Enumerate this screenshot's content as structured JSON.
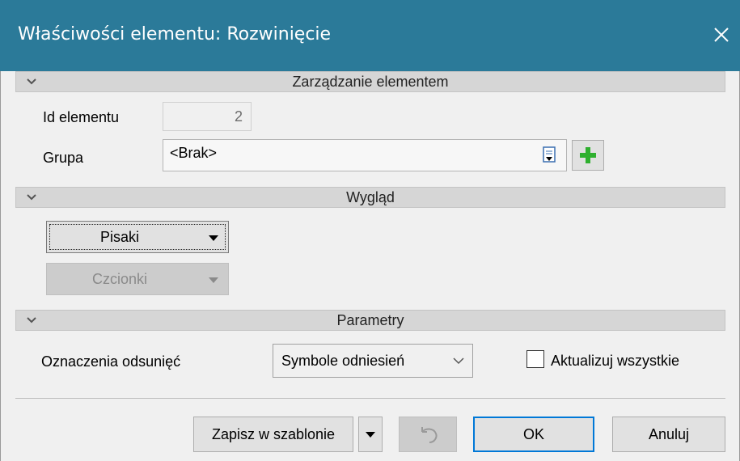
{
  "window": {
    "title": "Właściwości elementu: Rozwinięcie",
    "close_icon": "close-icon"
  },
  "sections": {
    "management": {
      "title": "Zarządzanie elementem"
    },
    "appearance": {
      "title": "Wygląd"
    },
    "parameters": {
      "title": "Parametry"
    }
  },
  "management": {
    "id_label": "Id elementu",
    "id_value": "2",
    "group_label": "Grupa",
    "group_value": "<Brak>"
  },
  "appearance": {
    "pens_label": "Pisaki",
    "fonts_label": "Czcionki"
  },
  "parameters": {
    "offset_label": "Oznaczenia odsunięć",
    "offset_value": "Symbole odniesień",
    "update_all_label": "Aktualizuj wszystkie",
    "update_all_checked": false
  },
  "footer": {
    "save_template_label": "Zapisz w szablonie",
    "ok_label": "OK",
    "cancel_label": "Anuluj"
  },
  "colors": {
    "titlebar": "#2b7a99",
    "accent_border": "#0078d7",
    "add_icon": "#2fb02f"
  }
}
